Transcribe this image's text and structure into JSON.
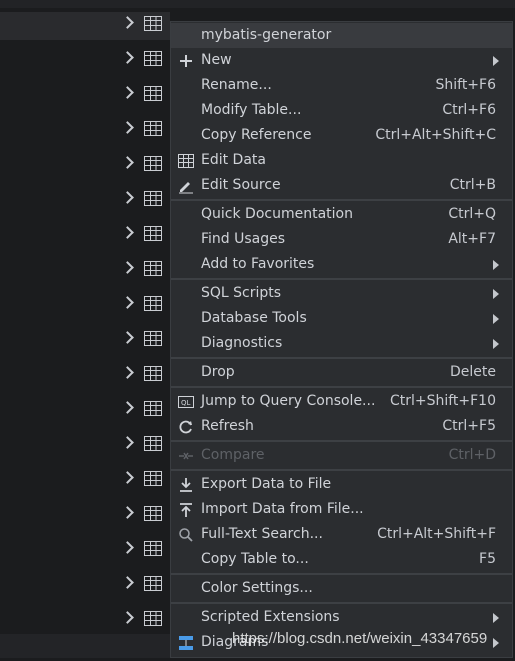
{
  "tree": {
    "row_count": 18
  },
  "menu": {
    "header": "mybatis-generator",
    "groups": [
      [
        {
          "label": "New",
          "shortcut": "",
          "submenu": true,
          "icon": "plus-icon"
        },
        {
          "label": "Rename...",
          "shortcut": "Shift+F6"
        },
        {
          "label": "Modify Table...",
          "shortcut": "Ctrl+F6"
        },
        {
          "label": "Copy Reference",
          "shortcut": "Ctrl+Alt+Shift+C"
        },
        {
          "label": "Edit Data",
          "shortcut": "",
          "icon": "table-icon"
        },
        {
          "label": "Edit Source",
          "shortcut": "Ctrl+B",
          "icon": "pencil-icon"
        }
      ],
      [
        {
          "label": "Quick Documentation",
          "shortcut": "Ctrl+Q"
        },
        {
          "label": "Find Usages",
          "shortcut": "Alt+F7"
        },
        {
          "label": "Add to Favorites",
          "shortcut": "",
          "submenu": true
        }
      ],
      [
        {
          "label": "SQL Scripts",
          "shortcut": "",
          "submenu": true
        },
        {
          "label": "Database Tools",
          "shortcut": "",
          "submenu": true
        },
        {
          "label": "Diagnostics",
          "shortcut": "",
          "submenu": true
        }
      ],
      [
        {
          "label": "Drop",
          "shortcut": "Delete"
        }
      ],
      [
        {
          "label": "Jump to Query Console...",
          "shortcut": "Ctrl+Shift+F10",
          "icon": "ql-icon"
        },
        {
          "label": "Refresh",
          "shortcut": "Ctrl+F5",
          "icon": "refresh-icon"
        }
      ],
      [
        {
          "label": "Compare",
          "shortcut": "Ctrl+D",
          "disabled": true,
          "icon": "compare-icon"
        }
      ],
      [
        {
          "label": "Export Data to File",
          "shortcut": "",
          "icon": "download-icon"
        },
        {
          "label": "Import Data from File...",
          "shortcut": "",
          "icon": "upload-icon"
        },
        {
          "label": "Full-Text Search...",
          "shortcut": "Ctrl+Alt+Shift+F",
          "icon": "search-icon"
        },
        {
          "label": "Copy Table to...",
          "shortcut": "F5"
        }
      ],
      [
        {
          "label": "Color Settings...",
          "shortcut": ""
        }
      ],
      [
        {
          "label": "Scripted Extensions",
          "shortcut": "",
          "submenu": true
        },
        {
          "label": "Diagrams",
          "shortcut": "",
          "submenu": true,
          "icon": "diagram-icon"
        }
      ]
    ]
  },
  "watermark": "https://blog.csdn.net/weixin_43347659",
  "colors": {
    "menu_bg": "#2b2d30",
    "highlight": "#393b3f",
    "separator": "#3d4044"
  }
}
